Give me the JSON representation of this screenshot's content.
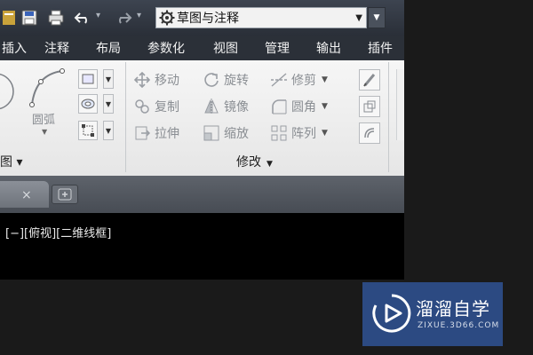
{
  "quick_access": {
    "save_icon": "save-icon",
    "print_icon": "print-icon",
    "undo_icon": "undo-icon",
    "redo_icon": "redo-icon",
    "workspace": {
      "icon": "gear-icon",
      "value": "草图与注释"
    }
  },
  "ribbon_tabs": [
    "插入",
    "注释",
    "布局",
    "参数化",
    "视图",
    "管理",
    "输出",
    "插件"
  ],
  "ribbon": {
    "draw_panel": {
      "arc_label": "圆弧",
      "panel_suffix": "图 ▾"
    },
    "modify_panel": {
      "label": "修改",
      "tools": {
        "move": "移动",
        "rotate": "旋转",
        "trim": "修剪",
        "copy": "复制",
        "mirror": "镜像",
        "fillet": "圆角",
        "stretch": "拉伸",
        "scale": "缩放",
        "array": "阵列"
      }
    }
  },
  "doc_tabs": {
    "close_glyph": "×"
  },
  "viewport": {
    "label": "[−][俯视][二维线框]"
  },
  "watermark": {
    "title": "溜溜自学",
    "url": "ZIXUE.3D66.COM"
  },
  "colors": {
    "ribbon_bg": "#ececec",
    "title_bar": "#353b45",
    "watermark_bg": "#2c4a82",
    "canvas_bg": "#000000"
  }
}
